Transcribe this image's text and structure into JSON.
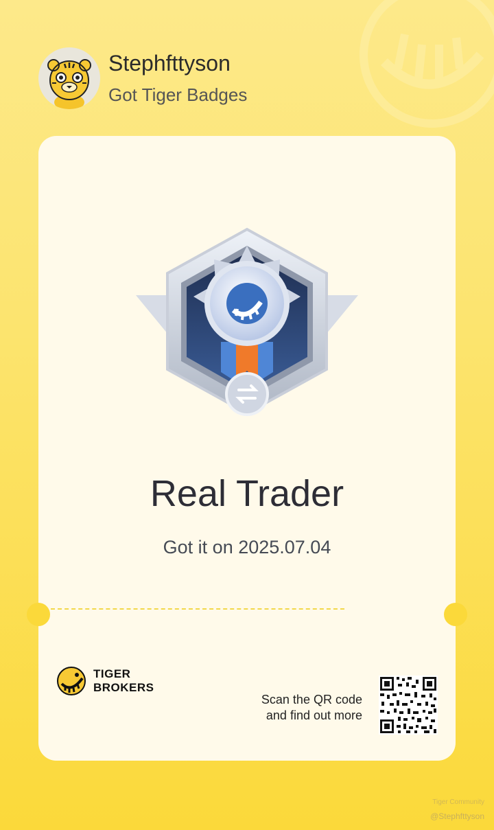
{
  "header": {
    "username": "Stephfttyson",
    "subtitle": "Got Tiger Badges",
    "avatar_icon": "tiger-avatar-icon"
  },
  "badge": {
    "icon": "real-trader-medal-icon",
    "title": "Real Trader",
    "date_text": "Got it on 2025.07.04"
  },
  "footer": {
    "brand_line1": "TIGER",
    "brand_line2": "BROKERS",
    "scan_line1": "Scan the QR code",
    "scan_line2": "and find out more",
    "qr_icon": "qr-code-icon"
  },
  "watermark": {
    "brand": "Tiger Community",
    "handle": "@Stephfttyson"
  },
  "colors": {
    "background_top": "#fde98a",
    "background_bottom": "#fbd93a",
    "card": "#fffaea",
    "medal_accent": "#f07a2a"
  }
}
